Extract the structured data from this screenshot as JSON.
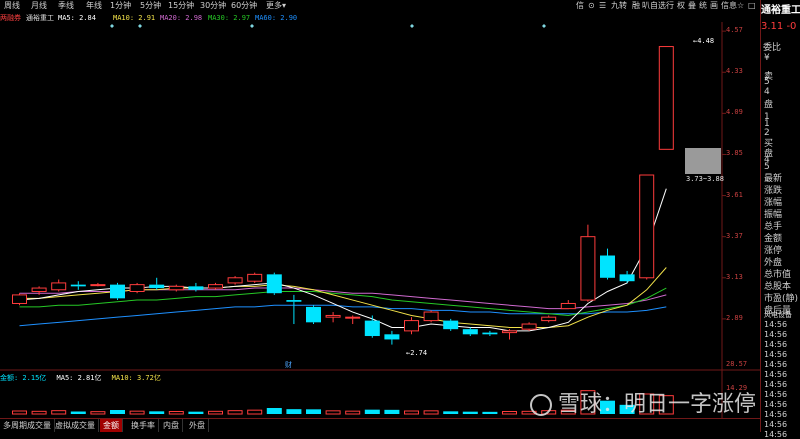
{
  "toolbar": {
    "periods": [
      "周线",
      "月线",
      "季线",
      "年线",
      "1分钟",
      "5分钟",
      "15分钟",
      "30分钟",
      "60分钟",
      "更多"
    ],
    "more_arrow": "▾",
    "right_tools": [
      "信",
      "⊙",
      "☰",
      "九转",
      "融",
      "叭自选",
      "行",
      "权",
      "叠",
      "统",
      "画",
      "信息",
      "☆",
      "□",
      "↓",
      "✕"
    ]
  },
  "stock": {
    "name": "通裕重工",
    "price": "3.11",
    "price_suffix": "-0"
  },
  "legend": {
    "tag": "两融券",
    "name": "通裕重工",
    "ma5": "MA5: 2.84",
    "ma10": "MA10: 2.91",
    "ma20": "MA20: 2.98",
    "ma30": "MA30: 2.97",
    "ma60": "MA60: 2.90"
  },
  "volume_legend": {
    "amount": "金额: 2.15亿",
    "ma5": "MA5: 2.81亿",
    "ma10": "MA10: 3.72亿"
  },
  "price_axis": [
    "4.57",
    "4.33",
    "4.09",
    "3.85",
    "3.61",
    "3.37",
    "3.13",
    "2.89"
  ],
  "volume_axis": [
    "28.57",
    "14.29"
  ],
  "annotations": {
    "high": "4.48",
    "low": "2.74",
    "range_label": "3.73~3.88",
    "event_marker": "财"
  },
  "right_panel": {
    "weibi": "委比",
    "sell_labels": [
      "¥",
      "卖",
      "5",
      "4",
      "盘",
      "1"
    ],
    "buy_labels": [
      "1",
      "2",
      "买",
      "盘",
      "4",
      "5"
    ],
    "stats": [
      "最新",
      "涨跌",
      "涨幅",
      "振幅",
      "总手",
      "金额",
      "涨停",
      "外盘",
      "总市值",
      "总股本",
      "市盈(静)",
      "盘后量"
    ],
    "fenjian": "风电设备",
    "times": [
      "14:56",
      "14:56",
      "14:56",
      "14:56",
      "14:56",
      "14:56",
      "14:56",
      "14:56",
      "14:56",
      "14:56",
      "14:56",
      "14:56"
    ]
  },
  "tabs": [
    "多周期成交量",
    "虚拟成交量",
    "金额",
    "换手率",
    "内盘",
    "外盘"
  ],
  "active_tab": "金额",
  "watermark": "雪球：明日一字涨停",
  "colors": {
    "up": "#ff3c3c",
    "down": "#00e4ff",
    "ma5": "#ffffff",
    "ma10": "#f2e24a",
    "ma20": "#26c826",
    "ma30": "#d06ad0",
    "ma60": "#1e90ff",
    "frame": "#701818"
  },
  "chart_data": {
    "type": "candlestick",
    "ylim": [
      2.65,
      4.6
    ],
    "candles": [
      {
        "o": 2.98,
        "c": 3.03,
        "h": 3.04,
        "l": 2.97
      },
      {
        "o": 3.05,
        "c": 3.07,
        "h": 3.08,
        "l": 3.03
      },
      {
        "o": 3.06,
        "c": 3.1,
        "h": 3.12,
        "l": 3.05
      },
      {
        "o": 3.09,
        "c": 3.08,
        "h": 3.11,
        "l": 3.06
      },
      {
        "o": 3.09,
        "c": 3.09,
        "h": 3.1,
        "l": 3.08
      },
      {
        "o": 3.09,
        "c": 3.01,
        "h": 3.1,
        "l": 3.0
      },
      {
        "o": 3.05,
        "c": 3.09,
        "h": 3.1,
        "l": 3.04
      },
      {
        "o": 3.09,
        "c": 3.07,
        "h": 3.13,
        "l": 3.06
      },
      {
        "o": 3.06,
        "c": 3.08,
        "h": 3.09,
        "l": 3.05
      },
      {
        "o": 3.08,
        "c": 3.06,
        "h": 3.1,
        "l": 3.05
      },
      {
        "o": 3.07,
        "c": 3.09,
        "h": 3.1,
        "l": 3.06
      },
      {
        "o": 3.1,
        "c": 3.13,
        "h": 3.14,
        "l": 3.09
      },
      {
        "o": 3.11,
        "c": 3.15,
        "h": 3.16,
        "l": 3.1
      },
      {
        "o": 3.15,
        "c": 3.04,
        "h": 3.16,
        "l": 3.03
      },
      {
        "o": 3.0,
        "c": 2.99,
        "h": 3.03,
        "l": 2.86
      },
      {
        "o": 2.96,
        "c": 2.87,
        "h": 2.97,
        "l": 2.86
      },
      {
        "o": 2.9,
        "c": 2.91,
        "h": 2.93,
        "l": 2.87
      },
      {
        "o": 2.9,
        "c": 2.9,
        "h": 2.91,
        "l": 2.86
      },
      {
        "o": 2.88,
        "c": 2.79,
        "h": 2.91,
        "l": 2.78
      },
      {
        "o": 2.8,
        "c": 2.77,
        "h": 2.82,
        "l": 2.74
      },
      {
        "o": 2.82,
        "c": 2.88,
        "h": 2.9,
        "l": 2.8
      },
      {
        "o": 2.88,
        "c": 2.93,
        "h": 2.94,
        "l": 2.87
      },
      {
        "o": 2.88,
        "c": 2.83,
        "h": 2.89,
        "l": 2.82
      },
      {
        "o": 2.83,
        "c": 2.8,
        "h": 2.84,
        "l": 2.79
      },
      {
        "o": 2.81,
        "c": 2.8,
        "h": 2.82,
        "l": 2.79
      },
      {
        "o": 2.81,
        "c": 2.82,
        "h": 2.83,
        "l": 2.77
      },
      {
        "o": 2.83,
        "c": 2.86,
        "h": 2.87,
        "l": 2.82
      },
      {
        "o": 2.88,
        "c": 2.9,
        "h": 2.91,
        "l": 2.87
      },
      {
        "o": 2.95,
        "c": 2.98,
        "h": 3.0,
        "l": 2.95
      },
      {
        "o": 3.0,
        "c": 3.37,
        "h": 3.44,
        "l": 2.99
      },
      {
        "o": 3.26,
        "c": 3.13,
        "h": 3.3,
        "l": 3.12
      },
      {
        "o": 3.15,
        "c": 3.11,
        "h": 3.17,
        "l": 3.1
      },
      {
        "o": 3.13,
        "c": 3.73,
        "h": 3.73,
        "l": 3.12
      },
      {
        "o": 3.88,
        "c": 4.48,
        "h": 4.48,
        "l": 3.88
      }
    ],
    "ma": {
      "ma5": [
        3.0,
        3.01,
        3.03,
        3.05,
        3.06,
        3.07,
        3.07,
        3.08,
        3.08,
        3.07,
        3.07,
        3.08,
        3.09,
        3.1,
        3.07,
        3.03,
        2.98,
        2.93,
        2.89,
        2.84,
        2.84,
        2.86,
        2.85,
        2.84,
        2.84,
        2.82,
        2.82,
        2.84,
        2.87,
        2.98,
        3.05,
        3.1,
        3.31,
        3.65
      ],
      "ma10": [
        3.01,
        3.01,
        3.02,
        3.03,
        3.04,
        3.05,
        3.06,
        3.06,
        3.07,
        3.07,
        3.07,
        3.08,
        3.08,
        3.09,
        3.08,
        3.06,
        3.03,
        3.0,
        2.97,
        2.94,
        2.91,
        2.89,
        2.87,
        2.86,
        2.85,
        2.84,
        2.84,
        2.84,
        2.85,
        2.9,
        2.94,
        2.97,
        3.06,
        3.19
      ],
      "ma20": [
        2.96,
        2.96,
        2.97,
        2.97,
        2.98,
        2.99,
        3.0,
        3.0,
        3.01,
        3.02,
        3.02,
        3.03,
        3.04,
        3.05,
        3.05,
        3.05,
        3.04,
        3.03,
        3.02,
        3.0,
        2.99,
        2.98,
        2.97,
        2.96,
        2.95,
        2.94,
        2.93,
        2.92,
        2.91,
        2.93,
        2.95,
        2.97,
        3.01,
        3.07
      ],
      "ma30": [
        3.04,
        3.04,
        3.04,
        3.05,
        3.05,
        3.05,
        3.06,
        3.06,
        3.06,
        3.06,
        3.06,
        3.06,
        3.07,
        3.07,
        3.07,
        3.06,
        3.05,
        3.04,
        3.04,
        3.03,
        3.02,
        3.01,
        3.0,
        2.99,
        2.98,
        2.97,
        2.96,
        2.95,
        2.95,
        2.96,
        2.97,
        2.98,
        3.0,
        3.03
      ],
      "ma60": [
        2.85,
        2.86,
        2.87,
        2.88,
        2.89,
        2.9,
        2.91,
        2.92,
        2.93,
        2.94,
        2.95,
        2.96,
        2.96,
        2.97,
        2.97,
        2.97,
        2.97,
        2.96,
        2.96,
        2.95,
        2.95,
        2.94,
        2.94,
        2.93,
        2.93,
        2.92,
        2.92,
        2.92,
        2.92,
        2.92,
        2.93,
        2.93,
        2.94,
        2.96
      ]
    },
    "volume_ylim": [
      0,
      30
    ],
    "volume": [
      1.8,
      1.6,
      2.0,
      1.5,
      1.4,
      2.4,
      1.7,
      1.6,
      1.5,
      1.4,
      1.6,
      2.0,
      2.3,
      3.6,
      2.9,
      2.8,
      1.9,
      1.7,
      2.6,
      2.5,
      1.8,
      1.9,
      1.6,
      1.4,
      1.3,
      1.5,
      1.6,
      2.0,
      2.3,
      14.0,
      8.0,
      5.5,
      12.0,
      11.0
    ]
  }
}
